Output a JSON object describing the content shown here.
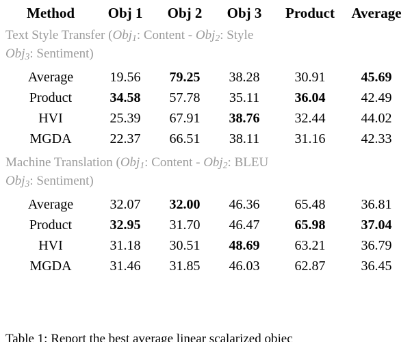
{
  "table": {
    "columns": [
      "Method",
      "Obj 1",
      "Obj 2",
      "Obj 3",
      "Product",
      "Average"
    ],
    "sections": [
      {
        "title_line1_pre": "Text Style Transfer (",
        "title_obj1": "Obj",
        "title_obj1_sub": "1",
        "title_line1_mid": ": Content - ",
        "title_obj2": "Obj",
        "title_obj2_sub": "2",
        "title_line1_post": ": Style",
        "title_obj3": "Obj",
        "title_obj3_sub": "3",
        "title_line2_post": ": Sentiment)",
        "rows": [
          {
            "method": "Average",
            "values": [
              "19.56",
              "79.25",
              "38.28",
              "30.91",
              "45.69"
            ],
            "bold": [
              false,
              true,
              false,
              false,
              true
            ]
          },
          {
            "method": "Product",
            "values": [
              "34.58",
              "57.78",
              "35.11",
              "36.04",
              "42.49"
            ],
            "bold": [
              true,
              false,
              false,
              true,
              false
            ]
          },
          {
            "method": "HVI",
            "values": [
              "25.39",
              "67.91",
              "38.76",
              "32.44",
              "44.02"
            ],
            "bold": [
              false,
              false,
              true,
              false,
              false
            ]
          },
          {
            "method": "MGDA",
            "values": [
              "22.37",
              "66.51",
              "38.11",
              "31.16",
              "42.33"
            ],
            "bold": [
              false,
              false,
              false,
              false,
              false
            ]
          }
        ]
      },
      {
        "title_line1_pre": "Machine Translation (",
        "title_obj1": "Obj",
        "title_obj1_sub": "1",
        "title_line1_mid": ": Content - ",
        "title_obj2": "Obj",
        "title_obj2_sub": "2",
        "title_line1_post": ": BLEU",
        "title_obj3": "Obj",
        "title_obj3_sub": "3",
        "title_line2_post": ": Sentiment)",
        "rows": [
          {
            "method": "Average",
            "values": [
              "32.07",
              "32.00",
              "46.36",
              "65.48",
              "36.81"
            ],
            "bold": [
              false,
              true,
              false,
              false,
              false
            ]
          },
          {
            "method": "Product",
            "values": [
              "32.95",
              "31.70",
              "46.47",
              "65.98",
              "37.04"
            ],
            "bold": [
              true,
              false,
              false,
              true,
              true
            ]
          },
          {
            "method": "HVI",
            "values": [
              "31.18",
              "30.51",
              "48.69",
              "63.21",
              "36.79"
            ],
            "bold": [
              false,
              false,
              true,
              false,
              false
            ]
          },
          {
            "method": "MGDA",
            "values": [
              "31.46",
              "31.85",
              "46.03",
              "62.87",
              "36.45"
            ],
            "bold": [
              false,
              false,
              false,
              false,
              false
            ]
          }
        ]
      }
    ]
  },
  "caption": {
    "text": "Table 1: Report the best average linear scalarized objec"
  },
  "colors": {
    "rule": "#000000",
    "section_header_text": "#9b9b9b",
    "body_text": "#000000"
  }
}
